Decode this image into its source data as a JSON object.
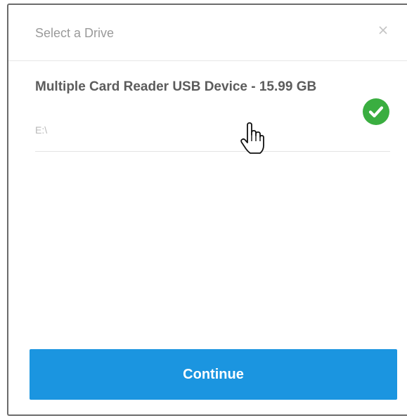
{
  "dialog": {
    "title": "Select a Drive",
    "close_symbol": "×"
  },
  "drives": [
    {
      "name": "Multiple Card Reader USB Device - 15.99 GB",
      "path": "E:\\",
      "selected": true,
      "status_icon": "check-circle-icon",
      "status_color": "#3aae40"
    }
  ],
  "actions": {
    "continue_label": "Continue",
    "continue_color": "#1b95e0"
  },
  "cursor": {
    "icon": "hand-pointer-icon"
  }
}
